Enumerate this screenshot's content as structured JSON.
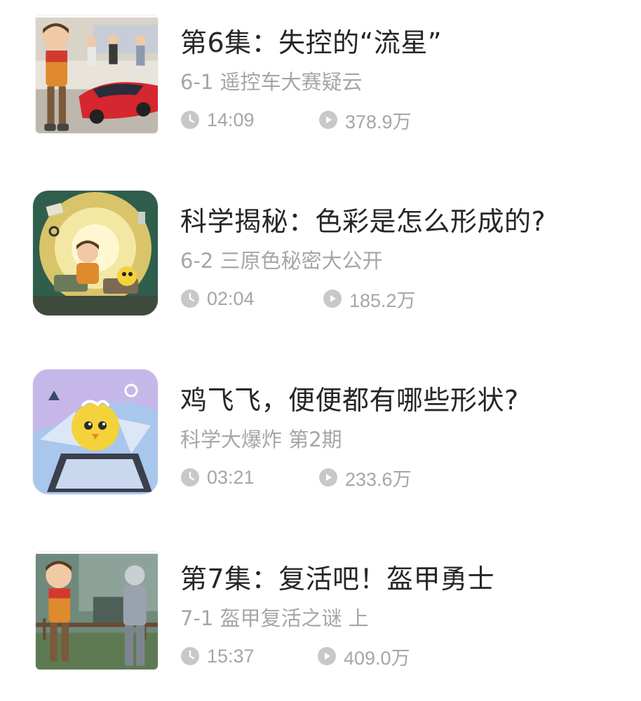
{
  "episodes": [
    {
      "title": "第6集：失控的“流星”",
      "subtitle": "6-1 遥控车大赛疑云",
      "duration": "14:09",
      "plays": "378.9万"
    },
    {
      "title": "科学揭秘：色彩是怎么形成的?",
      "subtitle": "6-2 三原色秘密大公开",
      "duration": "02:04",
      "plays": "185.2万"
    },
    {
      "title": "鸡飞飞，便便都有哪些形状?",
      "subtitle": "科学大爆炸 第2期",
      "duration": "03:21",
      "plays": "233.6万"
    },
    {
      "title": "第7集：复活吧！盔甲勇士",
      "subtitle": "7-1 盔甲复活之谜 上",
      "duration": "15:37",
      "plays": "409.0万"
    }
  ],
  "icons": {
    "duration": "clock-icon",
    "plays": "play-count-icon"
  },
  "colors": {
    "title": "#262626",
    "secondary": "#a6a6a6",
    "icon": "#c8c8c8"
  }
}
